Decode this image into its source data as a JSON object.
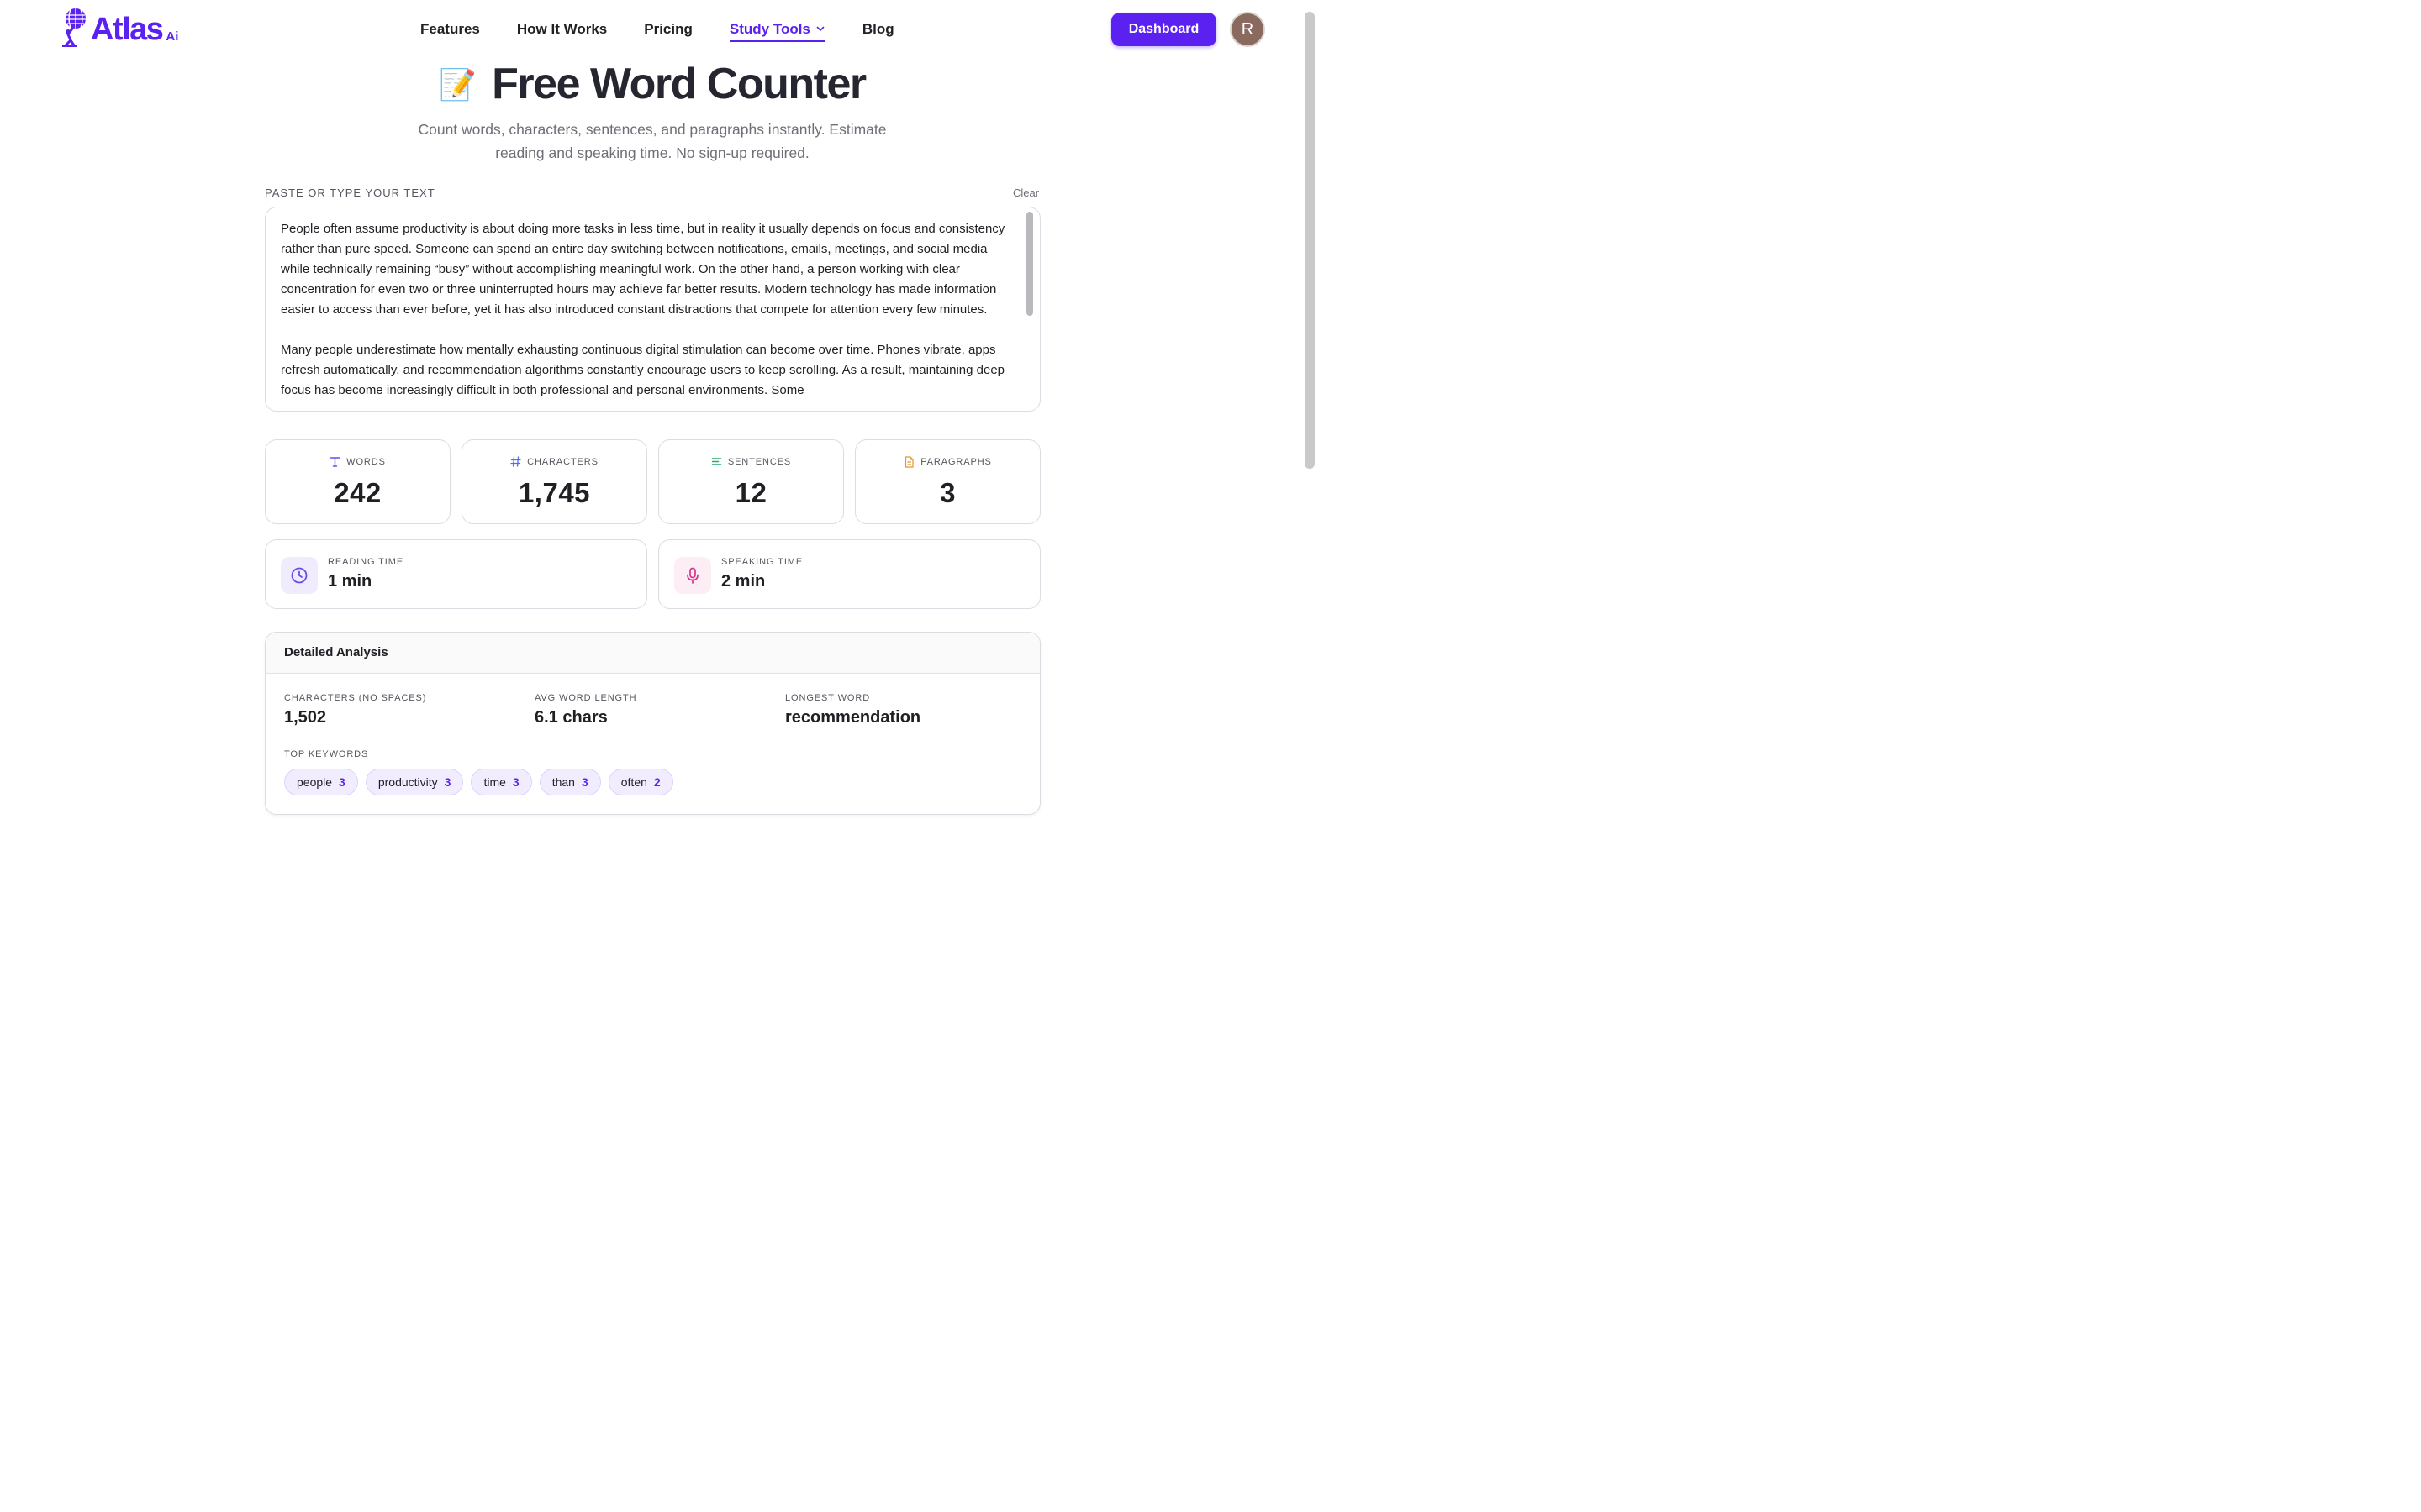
{
  "brand": {
    "name": "Atlas",
    "suffix": "Ai",
    "color": "#5b21f0"
  },
  "nav": {
    "items": [
      {
        "label": "Features"
      },
      {
        "label": "How It Works"
      },
      {
        "label": "Pricing"
      },
      {
        "label": "Study Tools",
        "active": true
      },
      {
        "label": "Blog"
      }
    ],
    "dashboard_label": "Dashboard",
    "avatar_initial": "R"
  },
  "hero": {
    "icon": "📝",
    "title": "Free Word Counter",
    "subtitle": "Count words, characters, sentences, and paragraphs instantly. Estimate reading and speaking time. No sign-up required."
  },
  "editor": {
    "label": "PASTE OR TYPE YOUR TEXT",
    "clear_label": "Clear",
    "paragraphs": [
      "People often assume productivity is about doing more tasks in less time, but in reality it usually depends on focus and consistency rather than pure speed. Someone can spend an entire day switching between notifications, emails, meetings, and social media while technically remaining “busy” without accomplishing meaningful work. On the other hand, a person working with clear concentration for even two or three uninterrupted hours may achieve far better results. Modern technology has made information easier to access than ever before, yet it has also introduced constant distractions that compete for attention every few minutes.",
      "Many people underestimate how mentally exhausting continuous digital stimulation can become over time. Phones vibrate, apps refresh automatically, and recommendation algorithms constantly encourage users to keep scrolling. As a result, maintaining deep focus has become increasingly difficult in both professional and personal environments. Some"
    ]
  },
  "stats": {
    "words": {
      "label": "WORDS",
      "value": "242"
    },
    "characters": {
      "label": "CHARACTERS",
      "value": "1,745"
    },
    "sentences": {
      "label": "SENTENCES",
      "value": "12"
    },
    "paragraphs": {
      "label": "PARAGRAPHS",
      "value": "3"
    }
  },
  "times": {
    "reading": {
      "label": "READING TIME",
      "value": "1 min"
    },
    "speaking": {
      "label": "SPEAKING TIME",
      "value": "2 min"
    }
  },
  "analysis": {
    "title": "Detailed Analysis",
    "chars_no_spaces": {
      "label": "CHARACTERS (NO SPACES)",
      "value": "1,502"
    },
    "avg_word_length": {
      "label": "AVG WORD LENGTH",
      "value": "6.1 chars"
    },
    "longest_word": {
      "label": "LONGEST WORD",
      "value": "recommendation"
    },
    "keywords_label": "TOP KEYWORDS",
    "keywords": [
      {
        "word": "people",
        "count": "3"
      },
      {
        "word": "productivity",
        "count": "3"
      },
      {
        "word": "time",
        "count": "3"
      },
      {
        "word": "than",
        "count": "3"
      },
      {
        "word": "often",
        "count": "2"
      }
    ]
  }
}
